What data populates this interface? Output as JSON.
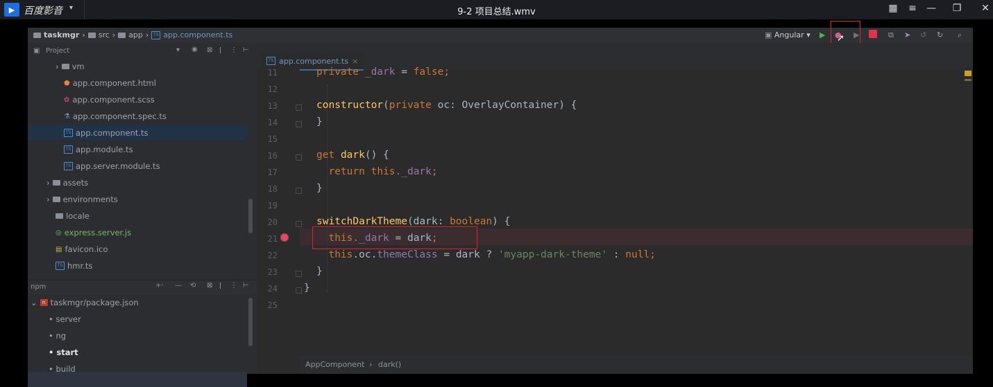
{
  "player": {
    "app_name": "百度影音",
    "menu_caret": "▾",
    "title": "9-2 项目总结.wmv"
  },
  "breadcrumb": [
    "taskmgr",
    "src",
    "app",
    "app.component.ts"
  ],
  "run_config": "Angular",
  "project_panel": {
    "title": "Project",
    "items": [
      {
        "label": "vm",
        "kind": "folder"
      },
      {
        "label": "app.component.html",
        "kind": "html"
      },
      {
        "label": "app.component.scss",
        "kind": "scss"
      },
      {
        "label": "app.component.spec.ts",
        "kind": "spec"
      },
      {
        "label": "app.component.ts",
        "kind": "ts"
      },
      {
        "label": "app.module.ts",
        "kind": "ts"
      },
      {
        "label": "app.server.module.ts",
        "kind": "ts"
      },
      {
        "label": "assets",
        "kind": "folder"
      },
      {
        "label": "environments",
        "kind": "folder"
      },
      {
        "label": "locale",
        "kind": "folder"
      },
      {
        "label": "express.server.js",
        "kind": "js"
      },
      {
        "label": "favicon.ico",
        "kind": "ico"
      },
      {
        "label": "hmr.ts",
        "kind": "ts"
      }
    ]
  },
  "npm_panel": {
    "title": "npm",
    "package": "taskmgr/package.json",
    "scripts": [
      "server",
      "ng",
      "start",
      "build"
    ]
  },
  "editor": {
    "tab": "app.component.ts",
    "line_numbers": [
      "11",
      "12",
      "13",
      "14",
      "15",
      "16",
      "17",
      "18",
      "19",
      "20",
      "21",
      "22",
      "23",
      "24",
      "25"
    ],
    "breadcrumb": [
      "AppComponent",
      "dark()"
    ]
  },
  "code": {
    "l11": {
      "kw": "private",
      "prop": "_dark",
      "op": " = ",
      "val": "false",
      "end": ";"
    },
    "l13": {
      "fn": "constructor",
      "open": "(",
      "kw": "private",
      "rest": " oc: OverlayContainer) {"
    },
    "l14": {
      "text": "}"
    },
    "l16": {
      "kw": "get",
      "fn": "dark",
      "rest": "() {"
    },
    "l17": {
      "kw1": "return",
      "kw2": "this",
      "prop": "._dark",
      "end": ";"
    },
    "l18": {
      "text": "}"
    },
    "l20": {
      "fn": "switchDarkTheme",
      "open": "(dark: ",
      "kw": "boolean",
      "rest": ") {"
    },
    "l21": {
      "kw": "this",
      "prop": "._dark",
      "rest": " = dark",
      "end": ";"
    },
    "l22": {
      "kw": "this",
      "mid": ".oc.",
      "prop": "themeClass",
      "rest": " = dark ? ",
      "str": "'myapp-dark-theme'",
      "rest2": " : ",
      "kw2": "null",
      "end": ";"
    },
    "l23": {
      "text": "}"
    },
    "l24": {
      "text": "}"
    }
  },
  "colors": {
    "highlight_box": "#e0212e",
    "breakpoint": "#e04b5f"
  }
}
